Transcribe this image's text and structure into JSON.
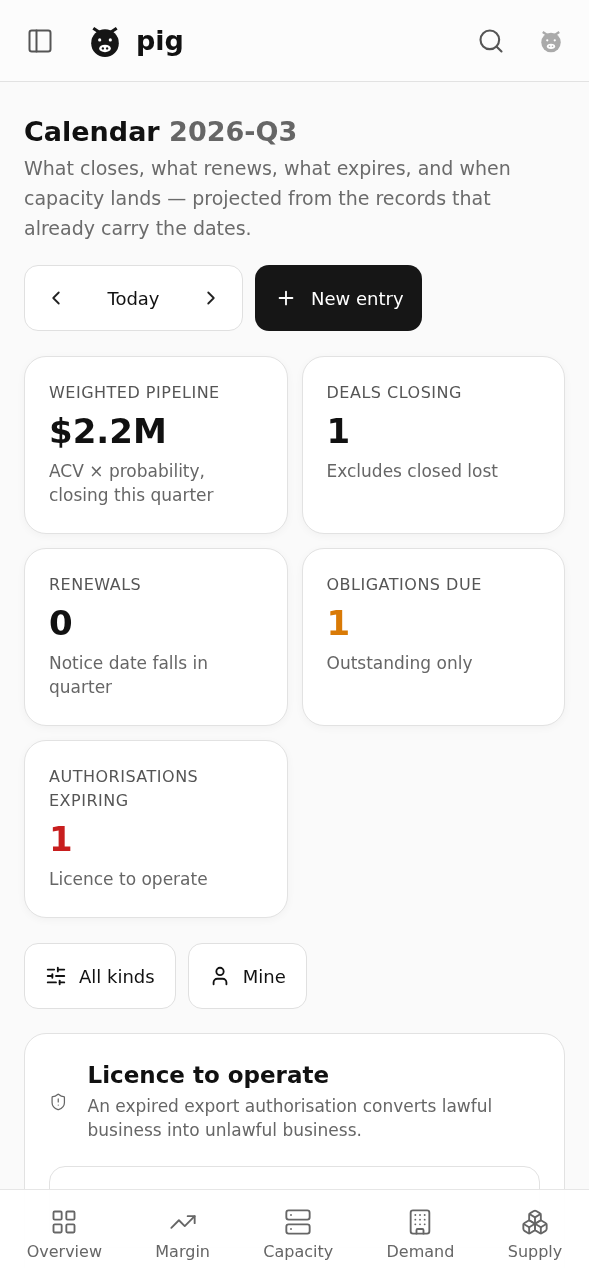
{
  "header": {
    "brand": "pig"
  },
  "page": {
    "title": "Calendar",
    "period": "2026-Q3",
    "description": "What closes, what renews, what expires, and when capacity lands — projected from the records that already carry the dates."
  },
  "toolbar": {
    "today": "Today",
    "new_entry": "New entry"
  },
  "stats": [
    {
      "label": "WEIGHTED PIPELINE",
      "value": "$2.2M",
      "note": "ACV × probability, closing this quarter",
      "color": "#111111"
    },
    {
      "label": "DEALS CLOSING",
      "value": "1",
      "note": "Excludes closed lost",
      "color": "#111111"
    },
    {
      "label": "RENEWALS",
      "value": "0",
      "note": "Notice date falls in quarter",
      "color": "#111111"
    },
    {
      "label": "OBLIGATIONS DUE",
      "value": "1",
      "note": "Outstanding only",
      "color": "#d97a06"
    },
    {
      "label": "AUTHORISATIONS EXPIRING",
      "value": "1",
      "note": "Licence to operate",
      "color": "#c81e1e"
    }
  ],
  "filters": [
    {
      "label": "All kinds",
      "kind": "sliders"
    },
    {
      "label": "Mine",
      "kind": "user"
    }
  ],
  "section": {
    "title": "Licence to operate",
    "description": "An expired export authorisation converts lawful business into unlawful business."
  },
  "nav": [
    {
      "label": "Overview",
      "kind": "grid"
    },
    {
      "label": "Margin",
      "kind": "trend"
    },
    {
      "label": "Capacity",
      "kind": "server"
    },
    {
      "label": "Demand",
      "kind": "building"
    },
    {
      "label": "Supply",
      "kind": "boxes"
    }
  ]
}
